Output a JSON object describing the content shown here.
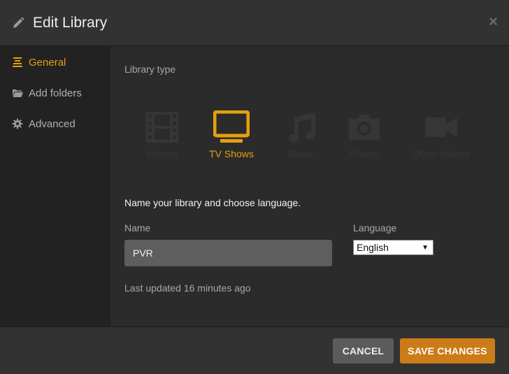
{
  "header": {
    "title": "Edit Library",
    "close_label": "×",
    "pencil_icon": "pencil-icon"
  },
  "sidebar": {
    "items": [
      {
        "label": "General",
        "icon": "general-icon",
        "active": true
      },
      {
        "label": "Add folders",
        "icon": "folder-icon",
        "active": false
      },
      {
        "label": "Advanced",
        "icon": "gear-icon",
        "active": false
      }
    ]
  },
  "library_type": {
    "label": "Library type",
    "selected": "TV Shows",
    "types": [
      {
        "label": "Movies",
        "icon": "film-icon"
      },
      {
        "label": "TV Shows",
        "icon": "tv-icon"
      },
      {
        "label": "Music",
        "icon": "music-icon"
      },
      {
        "label": "Photos",
        "icon": "camera-icon"
      },
      {
        "label": "Other Videos",
        "icon": "video-camera-icon"
      }
    ]
  },
  "form": {
    "heading": "Name your library and choose language.",
    "name_label": "Name",
    "name_value": "PVR",
    "language_label": "Language",
    "language_value": "English",
    "language_arrow": "▼"
  },
  "status": {
    "last_updated": "Last updated 16 minutes ago"
  },
  "footer": {
    "cancel_label": "CANCEL",
    "save_label": "SAVE CHANGES"
  },
  "colors": {
    "accent": "#e5a00d",
    "save_button": "#cc7b19",
    "cancel_button": "#5b5b5b",
    "inactive_type": "#363636"
  }
}
